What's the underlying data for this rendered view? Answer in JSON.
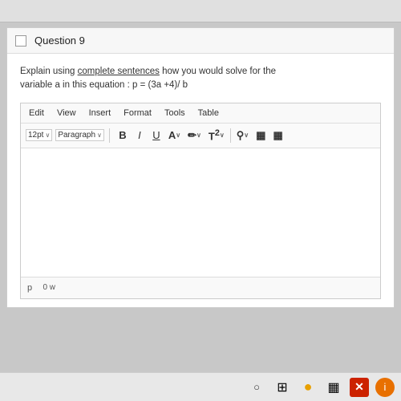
{
  "topbar": {},
  "question": {
    "title": "Question 9",
    "text_line1": "Explain using complete sentences how you would solve for the",
    "text_line2": "variable  a in this equation : p = (3a +4)/ b",
    "underlined": "complete sentences"
  },
  "editor": {
    "menu": {
      "edit": "Edit",
      "view": "View",
      "insert": "Insert",
      "format": "Format",
      "tools": "Tools",
      "table": "Table"
    },
    "toolbar": {
      "font_size": "12pt",
      "font_size_chevron": "∨",
      "paragraph": "Paragraph",
      "paragraph_chevron": "∨",
      "bold": "B",
      "italic": "I",
      "underline": "U",
      "font_color": "A",
      "highlight": "∕",
      "superscript": "T²",
      "link": "⚲",
      "image": "🖼"
    },
    "cursor_char": "p",
    "word_count": "0 w"
  },
  "taskbar": {
    "search_label": "O",
    "windows_label": "⊞",
    "chrome_label": "●",
    "task_label": "≡",
    "close_label": "✕",
    "info_label": "i"
  }
}
